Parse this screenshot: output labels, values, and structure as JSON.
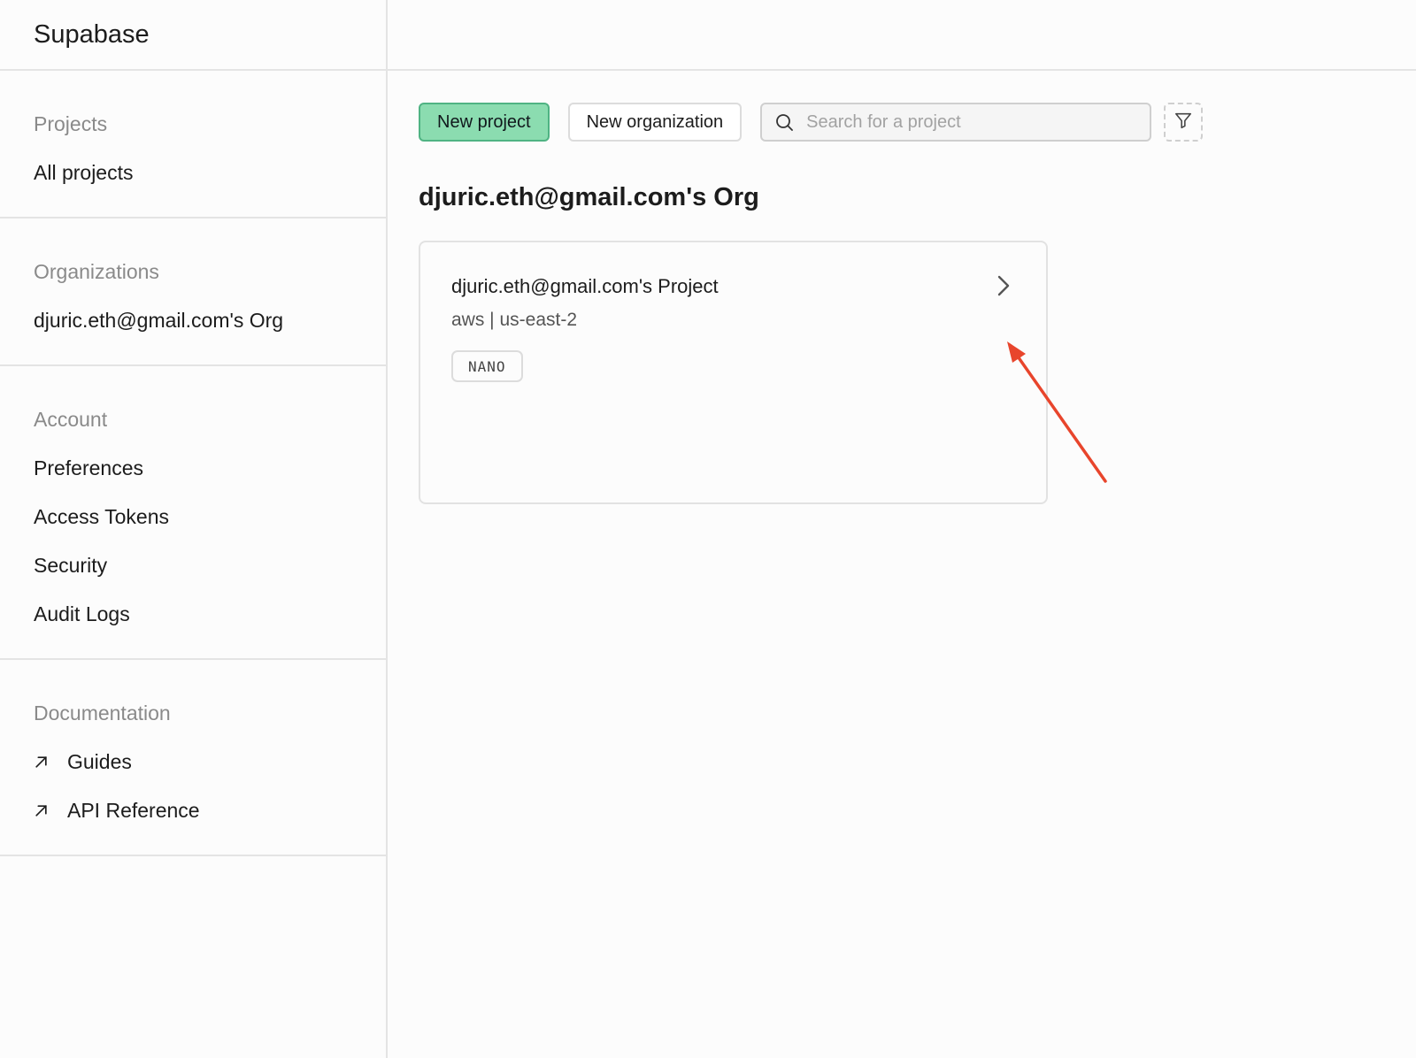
{
  "brand": {
    "name": "Supabase"
  },
  "sidebar": {
    "projects": {
      "heading": "Projects",
      "items": [
        "All projects"
      ]
    },
    "organizations": {
      "heading": "Organizations",
      "items": [
        "djuric.eth@gmail.com's Org"
      ]
    },
    "account": {
      "heading": "Account",
      "items": [
        "Preferences",
        "Access Tokens",
        "Security",
        "Audit Logs"
      ]
    },
    "documentation": {
      "heading": "Documentation",
      "items": [
        "Guides",
        "API Reference"
      ]
    }
  },
  "toolbar": {
    "new_project": "New project",
    "new_organization": "New organization",
    "search_placeholder": "Search for a project"
  },
  "org": {
    "title": "djuric.eth@gmail.com's Org",
    "projects": [
      {
        "name": "djuric.eth@gmail.com's Project",
        "region": "aws | us-east-2",
        "tier": "NANO"
      }
    ]
  },
  "colors": {
    "primary_bg": "#8bdcb0",
    "primary_border": "#4fb383",
    "annotation_arrow": "#e8452c"
  },
  "icons": {
    "search": "search-icon",
    "filter": "filter-icon",
    "external_link": "arrow-up-right-icon",
    "chevron": "chevron-right-icon"
  }
}
